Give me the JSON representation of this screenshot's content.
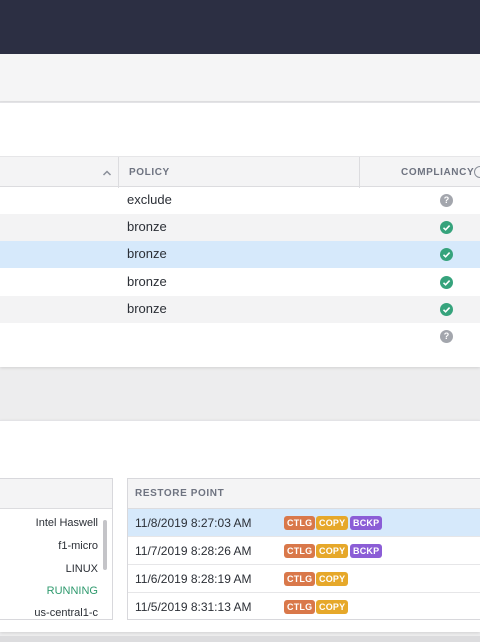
{
  "policy_table": {
    "columns": {
      "policy": "POLICY",
      "compliancy": "COMPLIANCY"
    },
    "rows": [
      {
        "policy": "exclude",
        "status": "unknown",
        "status_icon": "help-icon"
      },
      {
        "policy": "bronze",
        "status": "compliant",
        "status_icon": "check-circle-icon"
      },
      {
        "policy": "bronze",
        "status": "compliant",
        "status_icon": "check-circle-icon",
        "selected": true
      },
      {
        "policy": "bronze",
        "status": "compliant",
        "status_icon": "check-circle-icon"
      },
      {
        "policy": "bronze",
        "status": "compliant",
        "status_icon": "check-circle-icon"
      },
      {
        "policy": "",
        "status": "unknown",
        "status_icon": "help-icon"
      }
    ]
  },
  "details": {
    "items": [
      "Intel Haswell",
      "f1-micro",
      "LINUX",
      "RUNNING",
      "us-central1-c"
    ]
  },
  "restore_points": {
    "header": "RESTORE POINT",
    "rows": [
      {
        "time": "11/8/2019 8:27:03 AM",
        "tags": [
          "CTLG",
          "COPY",
          "BCKP"
        ],
        "selected": true
      },
      {
        "time": "11/7/2019 8:28:26 AM",
        "tags": [
          "CTLG",
          "COPY",
          "BCKP"
        ]
      },
      {
        "time": "11/6/2019 8:28:19 AM",
        "tags": [
          "CTLG",
          "COPY"
        ]
      },
      {
        "time": "11/5/2019 8:31:13 AM",
        "tags": [
          "CTLG",
          "COPY"
        ]
      }
    ]
  },
  "colors": {
    "topbar": "#2c2f43",
    "selected_row": "#d6e9fb",
    "compliant": "#36a37c",
    "unknown": "#a3a6ad",
    "running": "#2f9a6e",
    "tag_ctlg": "#d9784a",
    "tag_copy": "#e6a82a",
    "tag_bckp": "#8b5dd6"
  }
}
